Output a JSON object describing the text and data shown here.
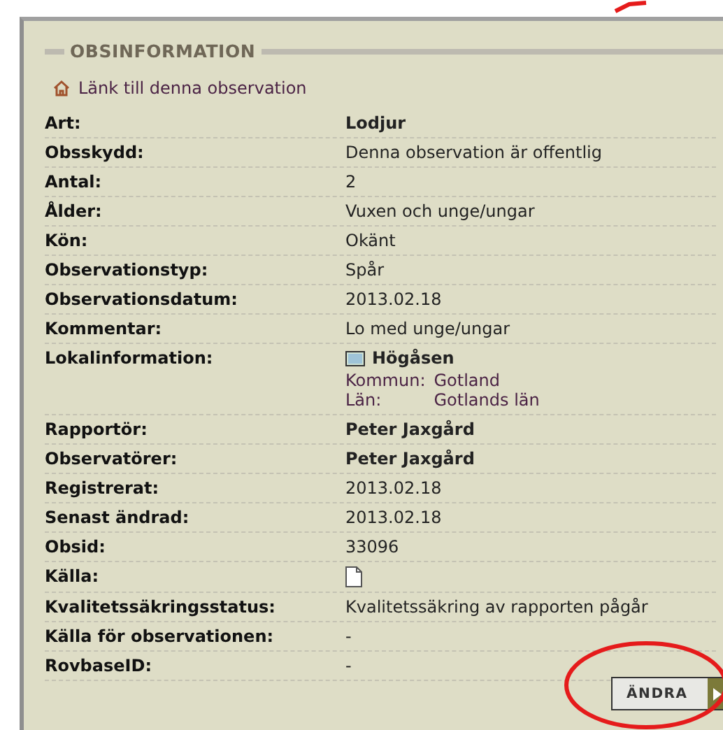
{
  "section": {
    "title": "OBSINFORMATION",
    "link": "Länk till denna observation"
  },
  "rows": [
    {
      "kind": "text",
      "label": "Art:",
      "value": "Lodjur",
      "strong": true
    },
    {
      "kind": "text",
      "label": "Obsskydd:",
      "value": "Denna observation är offentlig",
      "strong": false
    },
    {
      "kind": "text",
      "label": "Antal:",
      "value": "2",
      "strong": false
    },
    {
      "kind": "text",
      "label": "Ålder:",
      "value": "Vuxen och unge/ungar",
      "strong": false
    },
    {
      "kind": "text",
      "label": "Kön:",
      "value": "Okänt",
      "strong": false
    },
    {
      "kind": "text",
      "label": "Observationstyp:",
      "value": "Spår",
      "strong": false
    },
    {
      "kind": "text",
      "label": "Observationsdatum:",
      "value": "2013.02.18",
      "strong": false
    },
    {
      "kind": "text",
      "label": "Kommentar:",
      "value": "Lo med unge/ungar",
      "strong": false
    },
    {
      "kind": "location",
      "label": "Lokalinformation:",
      "value": "Högåsen",
      "strong": true,
      "details": [
        {
          "label": "Kommun:",
          "value": "Gotland"
        },
        {
          "label": "Län:",
          "value": "Gotlands län"
        }
      ]
    },
    {
      "kind": "text",
      "label": "Rapportör:",
      "value": "Peter Jaxgård",
      "strong": true
    },
    {
      "kind": "text",
      "label": "Observatörer:",
      "value": "Peter Jaxgård",
      "strong": true
    },
    {
      "kind": "text",
      "label": "Registrerat:",
      "value": "2013.02.18",
      "strong": false
    },
    {
      "kind": "text",
      "label": "Senast ändrad:",
      "value": "2013.02.18",
      "strong": false
    },
    {
      "kind": "text",
      "label": "Obsid:",
      "value": "33096",
      "strong": false
    },
    {
      "kind": "file",
      "label": "Källa:"
    },
    {
      "kind": "text",
      "label": "Kvalitetssäkringsstatus:",
      "value": "Kvalitetssäkring av rapporten pågår",
      "strong": false
    },
    {
      "kind": "text",
      "label": "Källa för observationen:",
      "value": "-",
      "strong": false
    },
    {
      "kind": "text",
      "label": "RovbaseID:",
      "value": "-",
      "strong": false
    }
  ],
  "button": {
    "label": "ÄNDRA"
  }
}
